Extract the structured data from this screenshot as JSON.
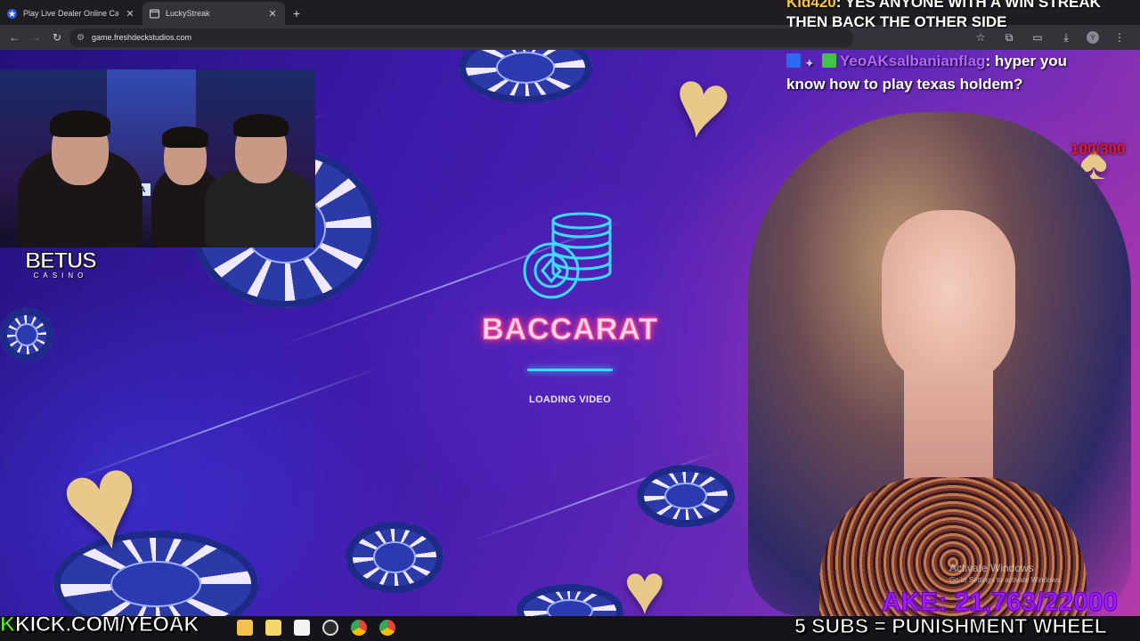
{
  "browser": {
    "tabs": [
      {
        "title": "Play Live Dealer Online Casino",
        "close": "✕",
        "active": false
      },
      {
        "title": "LuckyStreak",
        "close": "✕",
        "active": true
      }
    ],
    "new_tab": "+",
    "address": "game.freshdeckstudios.com",
    "back_icon": "←",
    "forward_icon": "→",
    "reload_icon": "↻",
    "star_icon": "☆",
    "profile_initial": "Y"
  },
  "game": {
    "title": "BACCARAT",
    "loading_text": "LOADING VIDEO",
    "loading_progress": 1.0
  },
  "overlay": {
    "webcam_sign": "MTA",
    "sponsor_word": "BETUS",
    "sponsor_sub": "CASINO",
    "chat": {
      "line1_user": "Kid420",
      "line1_text": ": YES ANYONE WITH A WIN STREAK",
      "line2_text": "THEN BACK THE OTHER SIDE",
      "line3_user": "YeoAKsalbanianflag",
      "line3_text": ": hyper you know how to play texas holdem?"
    },
    "counter": "100/300",
    "activate_title": "Activate Windows",
    "activate_sub": "Go to Settings to activate Windows.",
    "goal_text": "AKE: 21,763/22000",
    "kick_prefix": "K",
    "kick_text": "KICK.COM/YEOAK",
    "subs_text": "5 SUBS = PUNISHMENT WHEEL"
  },
  "colors": {
    "kick_green": "#53fc18",
    "chat_user1": "#f5c542",
    "chat_user2": "#b266ff",
    "counter_red": "#e01a2a",
    "goal_purple": "#a01aff",
    "neon_pink": "#ff4f9a",
    "neon_cyan": "#3adbff"
  }
}
